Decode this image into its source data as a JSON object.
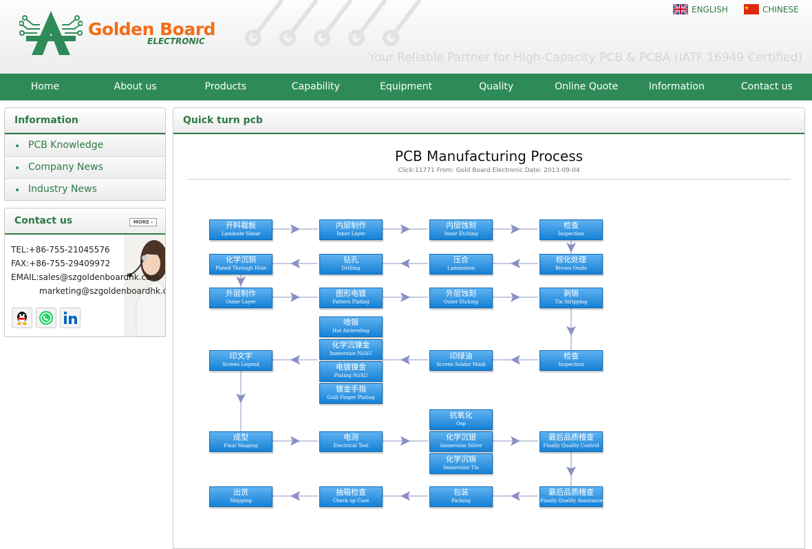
{
  "header": {
    "brand_name": "Golden Board",
    "brand_sub": "ELECTRONIC",
    "tagline": "Your Reliable Partner for High-Capacity PCB & PCBA (IATF 16949 Certified)",
    "languages": [
      {
        "label": "ENGLISH",
        "flag": "uk-flag-icon"
      },
      {
        "label": "CHINESE",
        "flag": "china-flag-icon"
      }
    ]
  },
  "nav": [
    "Home",
    "About us",
    "Products",
    "Capability",
    "Equipment",
    "Quality",
    "Online Quote",
    "Information",
    "Contact us"
  ],
  "sidebar": {
    "info_title": "Information",
    "info_items": [
      "PCB Knowledge",
      "Company News",
      "Industry News"
    ],
    "contact_title": "Contact us",
    "more_label": "MORE",
    "tel": "TEL:+86-755-21045576",
    "fax": "FAX:+86-755-29409972",
    "email1": "EMAIL:sales@szgoldenboardhk.com",
    "email2": "marketing@szgoldenboardhk.com",
    "social": [
      "qq-icon",
      "whatsapp-icon",
      "linkedin-icon"
    ]
  },
  "main": {
    "section_title": "Quick turn pcb",
    "article_title": "PCB Manufacturing Process",
    "article_meta": "Click:11771 From: Gold Board Electronic Date: 2013-09-04"
  },
  "flowchart": [
    {
      "cn": "开料裁板",
      "en": "Laminate Shear"
    },
    {
      "cn": "内层制作",
      "en": "Inner Layer"
    },
    {
      "cn": "内层蚀刻",
      "en": "Inner Etching"
    },
    {
      "cn": "检查",
      "en": "Inspection"
    },
    {
      "cn": "化学沉铜",
      "en": "Plated Through Hole"
    },
    {
      "cn": "钻孔",
      "en": "Drilling"
    },
    {
      "cn": "压合",
      "en": "Lamination"
    },
    {
      "cn": "棕化处理",
      "en": "Brown Oxide"
    },
    {
      "cn": "外层制作",
      "en": "Outer Layer"
    },
    {
      "cn": "图形电镀",
      "en": "Pattern Plating"
    },
    {
      "cn": "外层蚀刻",
      "en": "Outer Etching"
    },
    {
      "cn": "剥锡",
      "en": "Tin Stripping"
    },
    {
      "cn": "喷锡",
      "en": "Hot Airleveling"
    },
    {
      "cn": "化学沉镍金",
      "en": "Immersion Ni/AU"
    },
    {
      "cn": "电镀镍金",
      "en": "Plating Ni/AU"
    },
    {
      "cn": "镀金手指",
      "en": "Gold Finger Plating"
    },
    {
      "cn": "印文字",
      "en": "Screen Legend"
    },
    {
      "cn": "印绿油",
      "en": "Screen Solder Mask"
    },
    {
      "cn": "检查",
      "en": "Inspection"
    },
    {
      "cn": "抗氧化",
      "en": "Osp"
    },
    {
      "cn": "成型",
      "en": "Final Shaping"
    },
    {
      "cn": "电测",
      "en": "Electrical Test"
    },
    {
      "cn": "化学沉银",
      "en": "Immersion Silver"
    },
    {
      "cn": "最后品质稽查",
      "en": "Finally Quality Control"
    },
    {
      "cn": "化学沉锡",
      "en": "Immersion Tin"
    },
    {
      "cn": "出货",
      "en": "Shipping"
    },
    {
      "cn": "抽箱检查",
      "en": "Check up Case"
    },
    {
      "cn": "包装",
      "en": "Packing"
    },
    {
      "cn": "最后品质稽查",
      "en": "Finally Quality Assurance"
    }
  ],
  "colors": {
    "brand_green": "#2e8b57",
    "brand_orange": "#f26d16",
    "process_blue": "#1581d6"
  }
}
